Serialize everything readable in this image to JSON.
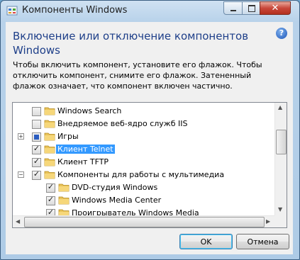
{
  "window": {
    "title": "Компоненты Windows",
    "close_glyph": "✕"
  },
  "dialog": {
    "heading": "Включение или отключение компонентов Windows",
    "help_glyph": "?",
    "description": "Чтобы включить компонент, установите его флажок. Чтобы отключить компонент, снимите его флажок. Затененный флажок означает, что компонент включен частично."
  },
  "tree": {
    "items": [
      {
        "label": "Windows Search",
        "state": "unchecked",
        "expander": ""
      },
      {
        "label": "Внедряемое веб-ядро служб IIS",
        "state": "unchecked",
        "expander": ""
      },
      {
        "label": "Игры",
        "state": "partial",
        "expander": "+"
      },
      {
        "label": "Клиент Telnet",
        "state": "checked",
        "expander": "",
        "selected": true
      },
      {
        "label": "Клиент TFTP",
        "state": "checked",
        "expander": ""
      },
      {
        "label": "Компоненты для работы с мультимедиа",
        "state": "checked",
        "expander": "−"
      },
      {
        "label": "DVD-студия Windows",
        "state": "checked",
        "expander": ""
      },
      {
        "label": "Windows Media Center",
        "state": "checked",
        "expander": ""
      },
      {
        "label": "Проигрыватель Windows Media",
        "state": "checked",
        "expander": ""
      }
    ],
    "check_glyph": "✓"
  },
  "buttons": {
    "ok": "OK",
    "cancel": "Отмена"
  },
  "colors": {
    "heading": "#1e3f89",
    "selection": "#3399ff",
    "folder": "#e8c35a"
  }
}
